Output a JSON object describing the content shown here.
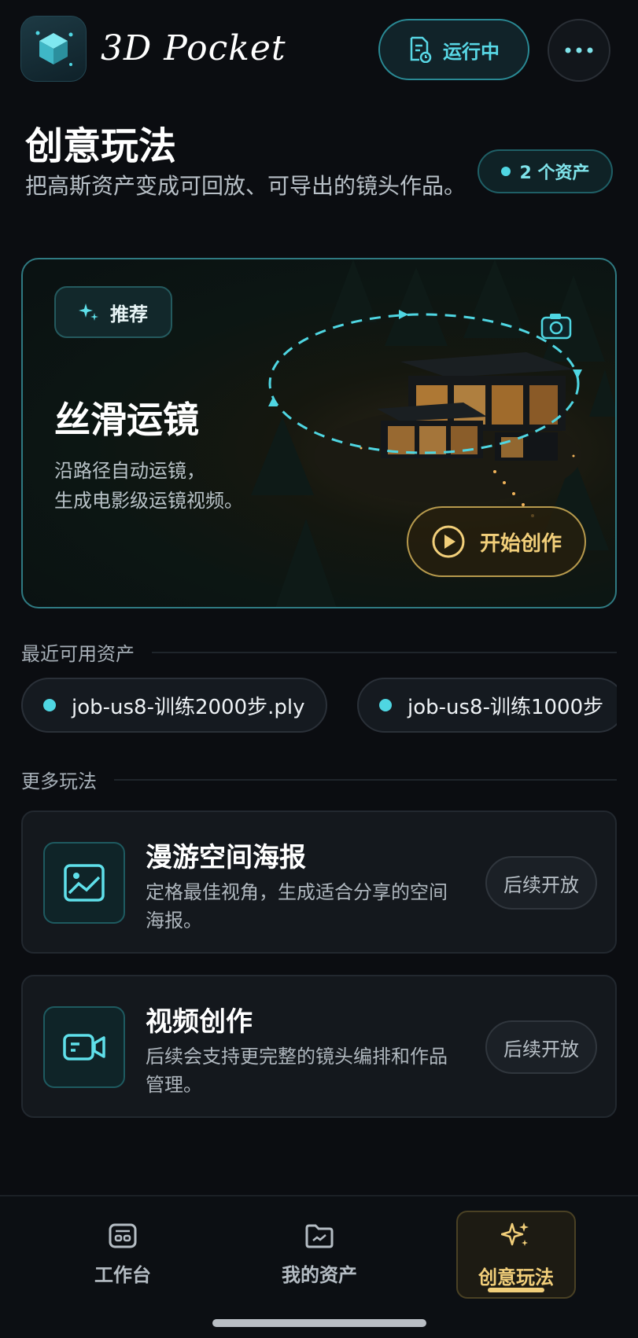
{
  "header": {
    "app_title": "3D Pocket",
    "status_label": "运行中",
    "logo_icon": "cube-logo-icon",
    "more_icon": "more-horizontal-icon"
  },
  "page": {
    "title": "创意玩法",
    "subtitle": "把高斯资产变成可回放、可导出的镜头作品。",
    "asset_count": "2 个资产"
  },
  "hero": {
    "badge_label": "推荐",
    "title": "丝滑运镜",
    "description_line1": "沿路径自动运镜，",
    "description_line2": "生成电影级运镜视频。",
    "start_label": "开始创作"
  },
  "recent": {
    "section_title": "最近可用资产",
    "assets": [
      {
        "name": "job-us8-训练2000步.ply"
      },
      {
        "name": "job-us8-训练1000步"
      }
    ]
  },
  "more": {
    "section_title": "更多玩法",
    "cards": [
      {
        "title": "漫游空间海报",
        "description": "定格最佳视角，生成适合分享的空间海报。",
        "status": "后续开放",
        "icon": "image-poster-icon"
      },
      {
        "title": "视频创作",
        "description": "后续会支持更完整的镜头编排和作品管理。",
        "status": "后续开放",
        "icon": "video-camera-icon"
      }
    ]
  },
  "nav": {
    "items": [
      {
        "label": "工作台",
        "icon": "workbench-icon"
      },
      {
        "label": "我的资产",
        "icon": "folder-icon"
      },
      {
        "label": "创意玩法",
        "icon": "sparkle-icon"
      }
    ],
    "active_index": 2
  },
  "colors": {
    "background": "#0b0d11",
    "accent_cyan": "#4fd6e2",
    "accent_gold": "#f2cf7a"
  }
}
